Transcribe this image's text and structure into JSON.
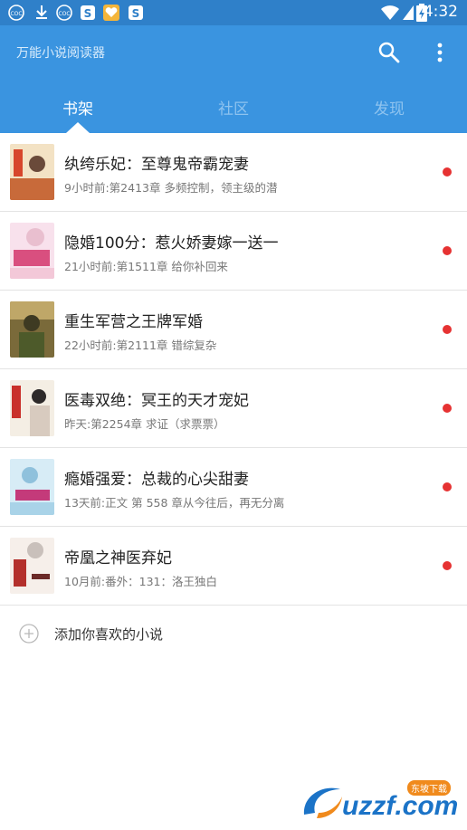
{
  "status_bar": {
    "time": "4:32",
    "icons": [
      "notify-app-icon",
      "download-icon",
      "notify-app-icon",
      "notify-s-icon",
      "heart-icon",
      "notify-s-icon",
      "wifi-icon",
      "signal-icon",
      "battery-icon"
    ]
  },
  "app": {
    "title": "万能小说阅读器",
    "actions": [
      "search-icon",
      "overflow-menu-icon"
    ]
  },
  "tabs": [
    {
      "label": "书架",
      "active": true
    },
    {
      "label": "社区",
      "active": false
    },
    {
      "label": "发现",
      "active": false
    }
  ],
  "books": [
    {
      "title": "纨绔乐妃：至尊鬼帝霸宠妻",
      "subtitle": "9小时前:第2413章 多频控制，领主级的潜",
      "unread": true
    },
    {
      "title": "隐婚100分：惹火娇妻嫁一送一",
      "subtitle": "21小时前:第1511章 给你补回来",
      "unread": true
    },
    {
      "title": "重生军营之王牌军婚",
      "subtitle": "22小时前:第2111章 错综复杂",
      "unread": true
    },
    {
      "title": "医毒双绝：冥王的天才宠妃",
      "subtitle": "昨天:第2254章 求证（求票票）",
      "unread": true
    },
    {
      "title": "瘾婚强爱：总裁的心尖甜妻",
      "subtitle": "13天前:正文 第 558 章从今往后，再无分离",
      "unread": true
    },
    {
      "title": "帝凰之神医弃妃",
      "subtitle": "10月前:番外：131：洛王独白",
      "unread": true
    }
  ],
  "add_novel": {
    "label": "添加你喜欢的小说"
  },
  "watermark": {
    "text": "uzzf.com",
    "badge": "东坡下载"
  },
  "colors": {
    "statusbar": "#2f80c9",
    "appbar": "#3a94e0",
    "unread_dot": "#e63232"
  }
}
